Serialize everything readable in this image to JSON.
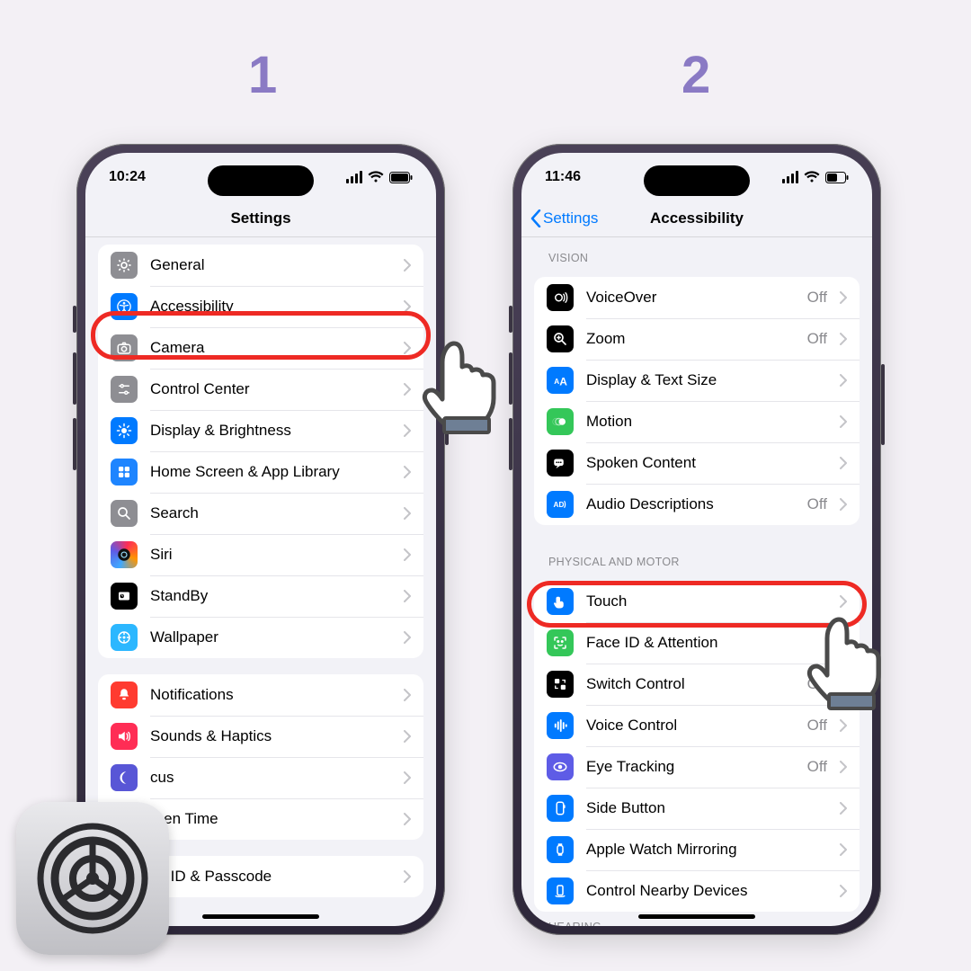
{
  "colors": {
    "accent": "#007aff",
    "highlight": "#ee2a24",
    "step_number": "#8a7ac4"
  },
  "step_labels": {
    "one": "1",
    "two": "2"
  },
  "phone1": {
    "status": {
      "time": "10:24"
    },
    "nav": {
      "title": "Settings"
    },
    "group1": [
      {
        "icon": "gear",
        "bg": "bg-gray",
        "label": "General"
      },
      {
        "icon": "access",
        "bg": "bg-blue",
        "label": "Accessibility",
        "highlight": true
      },
      {
        "icon": "camera",
        "bg": "bg-gray",
        "label": "Camera"
      },
      {
        "icon": "sliders",
        "bg": "bg-gray",
        "label": "Control Center"
      },
      {
        "icon": "bright",
        "bg": "bg-blue",
        "label": "Display & Brightness"
      },
      {
        "icon": "apps",
        "bg": "bg-blue2",
        "label": "Home Screen & App Library"
      },
      {
        "icon": "search",
        "bg": "bg-gray",
        "label": "Search"
      },
      {
        "icon": "siri",
        "bg": "gradient-siri",
        "label": "Siri"
      },
      {
        "icon": "standby",
        "bg": "bg-black",
        "label": "StandBy"
      },
      {
        "icon": "wall",
        "bg": "bg-cyan",
        "label": "Wallpaper"
      }
    ],
    "group2": [
      {
        "icon": "bell",
        "bg": "bg-red",
        "label": "Notifications"
      },
      {
        "icon": "speaker",
        "bg": "bg-pink",
        "label": "Sounds & Haptics"
      },
      {
        "icon": "moon",
        "bg": "bg-indigo",
        "label": "Focus",
        "truncated_label": "cus"
      },
      {
        "icon": "hourglass",
        "bg": "bg-indigo",
        "label": "Screen Time",
        "truncated_label": "reen Time"
      }
    ],
    "group3_first": {
      "label": "Face ID & Passcode",
      "truncated_label": "ce ID & Passcode"
    }
  },
  "phone2": {
    "status": {
      "time": "11:46"
    },
    "nav": {
      "back": "Settings",
      "title": "Accessibility"
    },
    "sections": {
      "vision": {
        "header": "VISION",
        "items": [
          {
            "icon": "voiceover",
            "bg": "bg-black",
            "label": "VoiceOver",
            "value": "Off"
          },
          {
            "icon": "zoom",
            "bg": "bg-black",
            "label": "Zoom",
            "value": "Off"
          },
          {
            "icon": "textsize",
            "bg": "bg-blue",
            "label": "Display & Text Size"
          },
          {
            "icon": "motion",
            "bg": "bg-green",
            "label": "Motion"
          },
          {
            "icon": "spoken",
            "bg": "bg-black",
            "label": "Spoken Content"
          },
          {
            "icon": "audiodesc",
            "bg": "bg-blue",
            "label": "Audio Descriptions",
            "value": "Off"
          }
        ]
      },
      "physical": {
        "header": "PHYSICAL AND MOTOR",
        "items": [
          {
            "icon": "touch",
            "bg": "bg-blue",
            "label": "Touch",
            "highlight": true
          },
          {
            "icon": "faceid",
            "bg": "bg-green",
            "label": "Face ID & Attention"
          },
          {
            "icon": "switch",
            "bg": "bg-black",
            "label": "Switch Control",
            "value": "Off"
          },
          {
            "icon": "voice",
            "bg": "bg-blue",
            "label": "Voice Control",
            "value": "Off"
          },
          {
            "icon": "eye",
            "bg": "bg-purple",
            "label": "Eye Tracking",
            "value": "Off"
          },
          {
            "icon": "sidebtn",
            "bg": "bg-blue",
            "label": "Side Button"
          },
          {
            "icon": "watch",
            "bg": "bg-blue",
            "label": "Apple Watch Mirroring"
          },
          {
            "icon": "nearby",
            "bg": "bg-blue",
            "label": "Control Nearby Devices"
          }
        ]
      },
      "next_header_peek": "HEARING"
    }
  }
}
